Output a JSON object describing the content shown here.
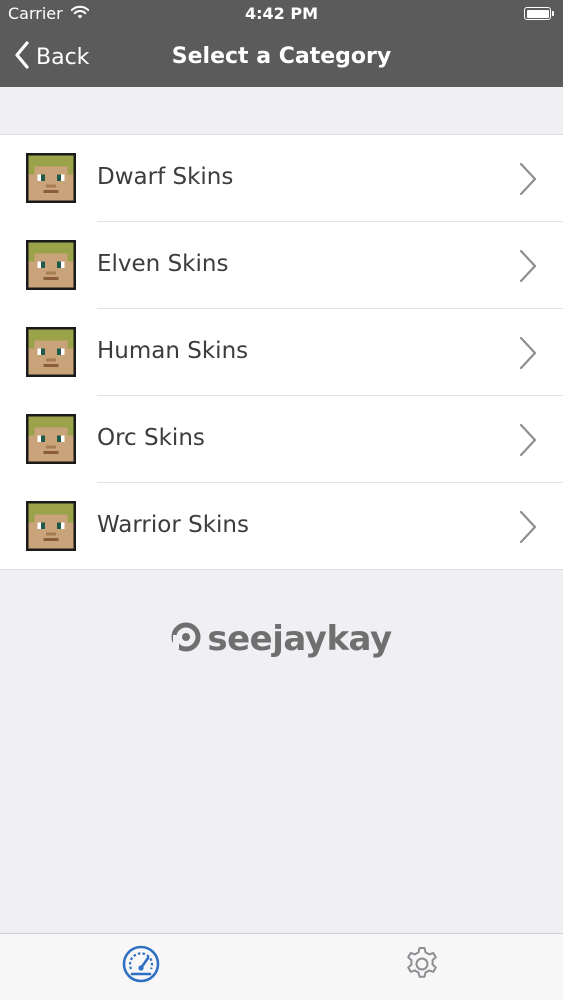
{
  "status_bar": {
    "carrier": "Carrier",
    "time": "4:42 PM"
  },
  "nav": {
    "back_label": "Back",
    "title": "Select a Category"
  },
  "categories": [
    {
      "label": "Dwarf Skins",
      "icon": "skin-head-icon"
    },
    {
      "label": "Elven Skins",
      "icon": "skin-head-icon"
    },
    {
      "label": "Human Skins",
      "icon": "skin-head-icon"
    },
    {
      "label": "Orc Skins",
      "icon": "skin-head-icon"
    },
    {
      "label": "Warrior Skins",
      "icon": "skin-head-icon"
    }
  ],
  "brand": {
    "logo_text": "seejaykay"
  },
  "tabbar": {
    "tabs": [
      {
        "icon": "dashboard-icon",
        "active": true
      },
      {
        "icon": "gear-icon",
        "active": false
      }
    ]
  },
  "colors": {
    "nav_bg": "#5b5b5b",
    "active_tab": "#2f6fc4",
    "inactive_tab": "#8e8e93"
  }
}
